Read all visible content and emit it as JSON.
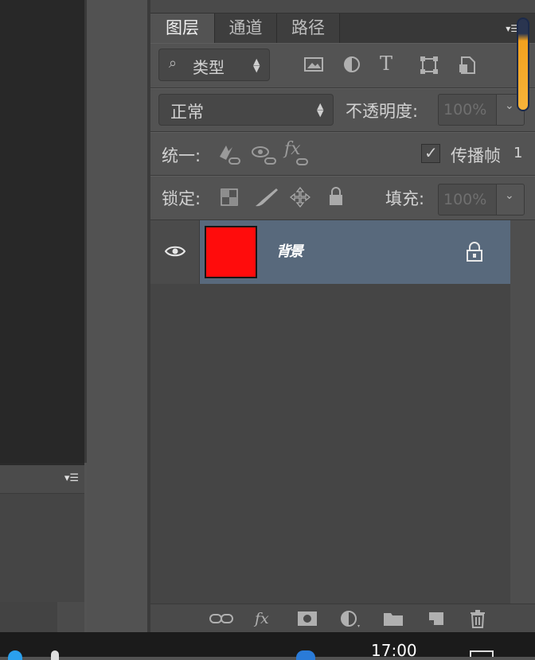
{
  "colors": {
    "panel_bg": "#454545",
    "row_bg": "#535353",
    "selected_layer": "#58697c",
    "layer_fill": "#ff0c0c",
    "slider_accent": "#f2a11e"
  },
  "left_panel": {
    "menu_icon": "menu-icon"
  },
  "tabs": [
    {
      "label": "图层",
      "active": true
    },
    {
      "label": "通道",
      "active": false
    },
    {
      "label": "路径",
      "active": false
    }
  ],
  "filter": {
    "type_label": "类型",
    "icons": [
      "image-filter-icon",
      "adjustment-filter-icon",
      "text-filter-icon",
      "shape-filter-icon",
      "smart-object-filter-icon"
    ],
    "text_icon_glyph": "T"
  },
  "blend": {
    "mode": "正常",
    "opacity_label": "不透明度:",
    "opacity_value": "100%"
  },
  "unify": {
    "label": "统一:",
    "fx_glyph": "fx",
    "propagate_label": "传播帧",
    "propagate_checked": true,
    "frame_number": "1"
  },
  "lock": {
    "label": "锁定:",
    "fill_label": "填充:",
    "fill_value": "100%"
  },
  "layers": [
    {
      "name": "背景",
      "visible": true,
      "locked": true,
      "thumb_color": "#ff0c0c"
    }
  ],
  "bottom_toolbar": {
    "fx_glyph": "fx",
    "icons": [
      "link-layers-icon",
      "fx-icon",
      "mask-icon",
      "adjustment-layer-icon",
      "group-folder-icon",
      "new-layer-icon",
      "trash-icon"
    ]
  },
  "taskbar": {
    "time": "17:00"
  }
}
